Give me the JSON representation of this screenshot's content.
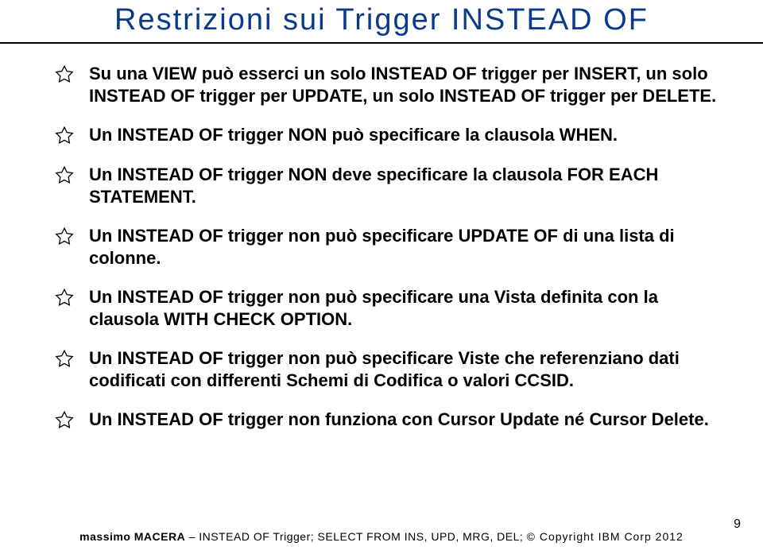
{
  "title": "Restrizioni sui Trigger INSTEAD OF",
  "bullets": [
    "Su una VIEW può esserci un solo INSTEAD OF trigger per INSERT, un solo INSTEAD OF trigger per UPDATE, un solo INSTEAD OF trigger per DELETE.",
    "Un INSTEAD OF trigger NON può specificare la clausola WHEN.",
    "Un INSTEAD OF trigger NON deve specificare la clausola FOR EACH STATEMENT.",
    "Un INSTEAD OF trigger non può specificare UPDATE OF di una lista di colonne.",
    "Un INSTEAD OF trigger non può specificare una Vista definita con la clausola WITH CHECK OPTION.",
    "Un INSTEAD OF trigger non può specificare Viste che referenziano dati codificati con differenti Schemi di Codifica o valori CCSID.",
    "Un INSTEAD OF trigger non funziona con Cursor Update né Cursor Delete."
  ],
  "footer": {
    "author": "massimo MACERA",
    "sep": " – ",
    "topic": "INSTEAD OF Trigger; SELECT FROM INS, UPD, MRG, DEL",
    "copy_sep": ";   ",
    "copyright": "© Copyright IBM Corp 2012"
  },
  "page_number": "9"
}
